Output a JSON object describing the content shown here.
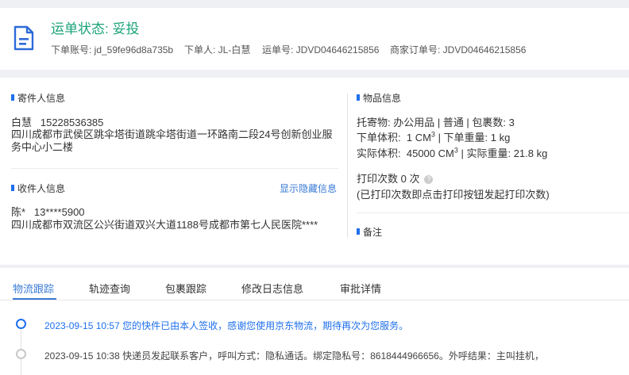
{
  "header": {
    "status_label": "运单状态:",
    "status_value": "妥投",
    "account": "下单账号: jd_59fe96d8a735b",
    "orderer": "下单人: JL-白慧",
    "waybill_no": "运单号: JDVD04646215856",
    "merchant_order_no": "商家订单号: JDVD04646215856",
    "icon": "document-icon"
  },
  "sender": {
    "section_title": "寄件人信息",
    "name": "白慧",
    "phone": "15228536385",
    "address": "四川成都市武侯区跳伞塔街道跳伞塔街道一环路南二段24号创新创业服务中心小二楼"
  },
  "receiver": {
    "section_title": "收件人信息",
    "toggle_link": "显示隐藏信息",
    "name": "陈*",
    "phone": "13****5900",
    "address": "四川成都市双流区公兴街道双兴大道1188号成都市第七人民医院****"
  },
  "goods": {
    "section_title": "物品信息",
    "line1": "托寄物: 办公用品 | 普通 | 包裹数: 3",
    "order_volume_label": "下单体积:",
    "order_volume_value": "1 CM",
    "order_weight": "| 下单重量: 1 kg",
    "actual_volume_label": "实际体积:",
    "actual_volume_value": "45000 CM",
    "actual_weight": "| 实际重量: 21.8 kg",
    "cube_sup": "3",
    "print_count": "打印次数  0 次",
    "print_note": "(已打印次数即点击打印按钮发起打印次数)",
    "remark_title": "备注"
  },
  "tabs": [
    "物流跟踪",
    "轨迹查询",
    "包裹跟踪",
    "修改日志信息",
    "审批详情"
  ],
  "active_tab": "物流跟踪",
  "events": [
    {
      "time": "2023-09-15 10:57",
      "text": "您的快件已由本人签收，感谢您使用京东物流，期待再次为您服务。"
    },
    {
      "time": "2023-09-15 10:38",
      "text": "快递员发起联系客户，呼叫方式：隐私通话。绑定隐私号：8618444966656。外呼结果：主叫挂机，"
    }
  ],
  "colors": {
    "status_green": "#1ca37a",
    "accent_blue": "#1f6feb",
    "link_blue": "#3a7bd5"
  }
}
